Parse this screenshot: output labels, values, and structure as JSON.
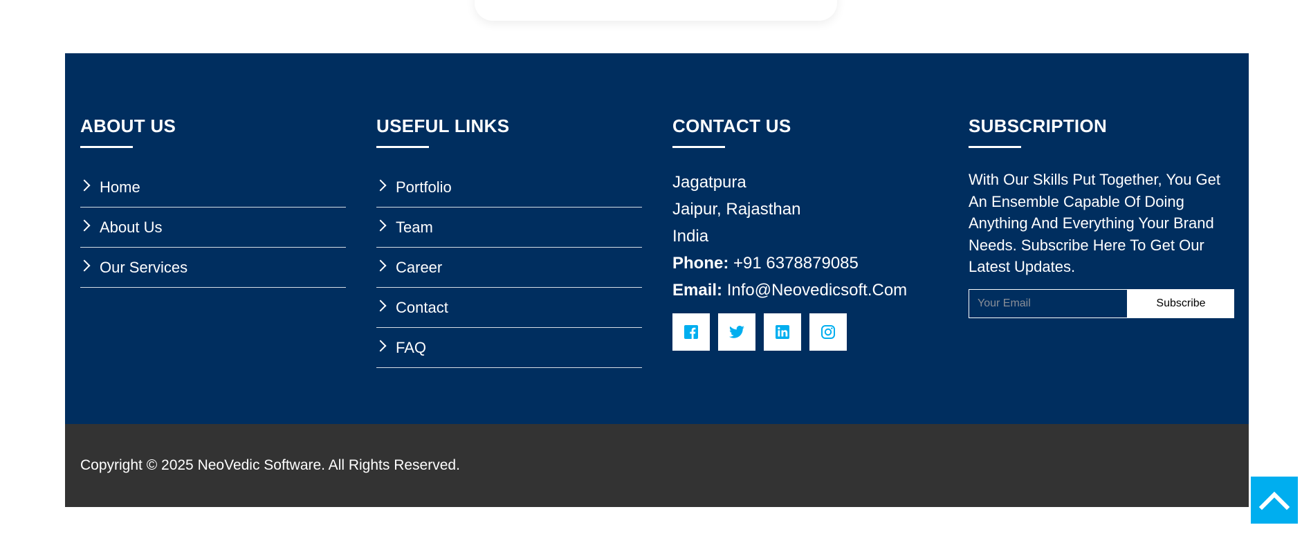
{
  "about": {
    "heading": "ABOUT US",
    "items": [
      {
        "label": "Home"
      },
      {
        "label": "About Us"
      },
      {
        "label": "Our Services"
      }
    ]
  },
  "useful_links": {
    "heading": "USEFUL LINKS",
    "items": [
      {
        "label": "Portfolio"
      },
      {
        "label": "Team"
      },
      {
        "label": "Career"
      },
      {
        "label": "Contact"
      },
      {
        "label": "FAQ"
      }
    ]
  },
  "contact": {
    "heading": "CONTACT US",
    "address_line1": "Jagatpura",
    "address_line2": "Jaipur, Rajasthan",
    "address_line3": "India",
    "phone_label": "Phone:",
    "phone_value": "+91 6378879085",
    "email_label": "Email:",
    "email_value": "Info@Neovedicsoft.Com",
    "social_icons": [
      "facebook-icon",
      "twitter-icon",
      "linkedin-icon",
      "instagram-icon"
    ],
    "social_color": "#00aeef"
  },
  "subscription": {
    "heading": "SUBSCRIPTION",
    "text": "With Our Skills Put Together, You Get An Ensemble Capable Of Doing Anything And Everything Your Brand Needs. Subscribe Here To Get Our Latest Updates.",
    "input_placeholder": "Your Email",
    "button_label": "Subscribe"
  },
  "bottom": {
    "copyright": "Copyright © 2025 NeoVedic Software. All Rights Reserved."
  },
  "colors": {
    "footer_bg": "#002e5f",
    "bottom_bg": "#333333",
    "accent": "#00aeef"
  }
}
